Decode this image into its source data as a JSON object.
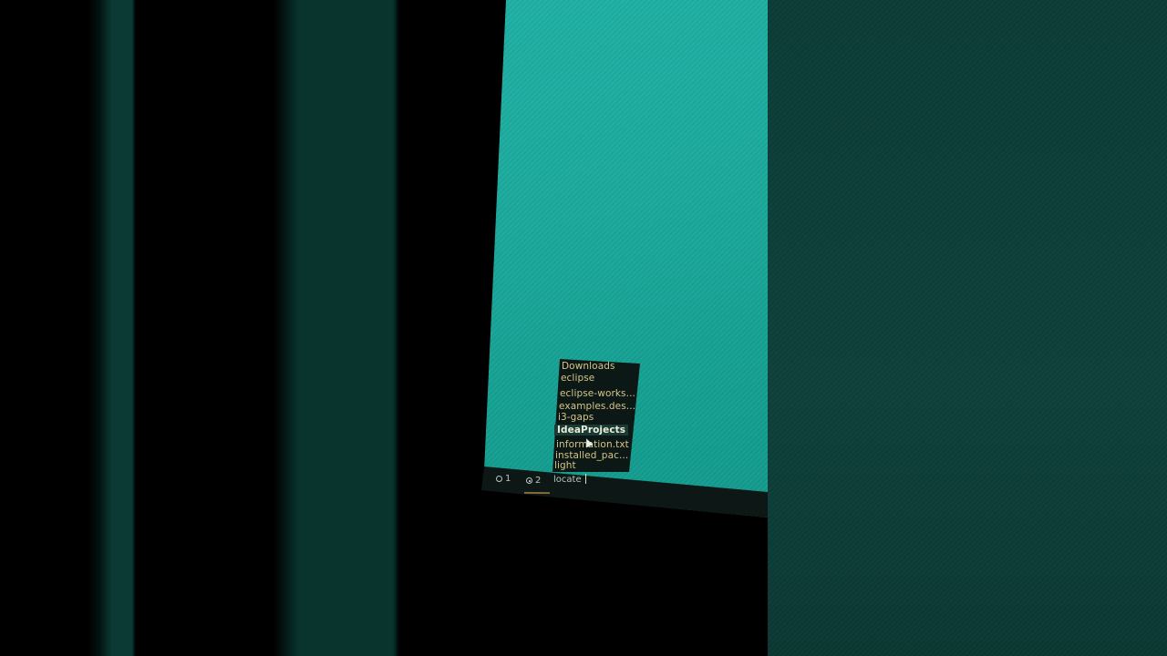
{
  "completion_menu": {
    "items": [
      {
        "label": "Downloads",
        "selected": false
      },
      {
        "label": "eclipse",
        "selected": false
      },
      {
        "label": "eclipse-works...",
        "selected": false
      },
      {
        "label": "examples.des...",
        "selected": false
      },
      {
        "label": "i3-gaps",
        "selected": false
      },
      {
        "label": "IdeaProjects",
        "selected": true
      },
      {
        "label": "information.txt",
        "selected": false
      },
      {
        "label": "installed_pac...",
        "selected": false
      },
      {
        "label": "light",
        "selected": false
      }
    ]
  },
  "status_bar": {
    "workspaces": [
      {
        "label": "1",
        "active": false
      },
      {
        "label": "2",
        "active": true
      }
    ],
    "prompt_text": "locate"
  },
  "colors": {
    "desktop": "#1aa99c",
    "bar_bg": "#0d1715",
    "menu_text": "#d6c587",
    "menu_selected_bg": "#1b3a35"
  }
}
